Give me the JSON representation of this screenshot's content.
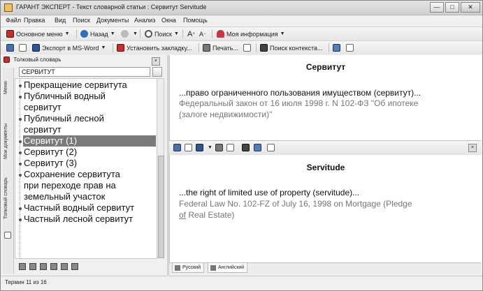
{
  "window": {
    "title": "ГАРАНТ ЭКСПЕРТ - Текст словарной статьи : Сервитут Servitude",
    "controls": {
      "minimize": "—",
      "maximize": "□",
      "close": "✕"
    }
  },
  "menu": [
    "Файл",
    "Правка",
    "Вид",
    "Поиск",
    "Документы",
    "Анализ",
    "Окна",
    "Помощь"
  ],
  "toolbar1": {
    "main_menu": "Основное меню",
    "back": "Назад",
    "search": "Поиск",
    "font_a1": "A",
    "font_a2": "A",
    "my_info": "Моя информация"
  },
  "toolbar2": {
    "export_word": "Экспорт в MS-Word",
    "set_bookmark": "Установить закладку...",
    "print": "Печать...",
    "context_search": "Поиск контекста..."
  },
  "left_panel": {
    "title": "Толковый словарь",
    "close": "×",
    "search_value": "СЕРВИТУТ",
    "vertical_tabs": [
      "Меню",
      "Мои документы",
      "Толковый словарь"
    ],
    "items": [
      {
        "text": "Прекращение сервитута",
        "selected": false
      },
      {
        "text": "Публичный водный",
        "selected": false
      },
      {
        "text": "сервитут",
        "selected": false,
        "continuation": true
      },
      {
        "text": "Публичный лесной",
        "selected": false
      },
      {
        "text": "сервитут",
        "selected": false,
        "continuation": true
      },
      {
        "text": "Сервитут (1)",
        "selected": true
      },
      {
        "text": "Сервитут (2)",
        "selected": false
      },
      {
        "text": "Сервитут (3)",
        "selected": false
      },
      {
        "text": "Сохранение сервитута",
        "selected": false
      },
      {
        "text": "при переходе прав на",
        "selected": false,
        "continuation": true
      },
      {
        "text": "земельный участок",
        "selected": false,
        "continuation": true
      },
      {
        "text": "Частный водный сервитут",
        "selected": false
      },
      {
        "text": "Частный лесной сервитут",
        "selected": false
      }
    ]
  },
  "doc_ru": {
    "title": "Сервитут",
    "line1": "...право ограниченного пользования имуществом (сервитут)...",
    "line2": "Федеральный закон от 16 июля 1998 г. N 102-ФЗ \"Об ипотеке",
    "line3_u": "(",
    "line3_rest": "залоге недвижимости)\""
  },
  "doc_en": {
    "title": "Servitude",
    "line1": "...the right of limited use of property (servitude)...",
    "line2": "Federal Law No. 102-FZ of July 16, 1998 on Mortgage (Pledge",
    "line3_u": "of",
    "line3_rest": " Real Estate)"
  },
  "bottom_pane": {
    "close": "×"
  },
  "lang_tabs": [
    "Русский",
    "Английский"
  ],
  "status": "Термин 11 из 16"
}
